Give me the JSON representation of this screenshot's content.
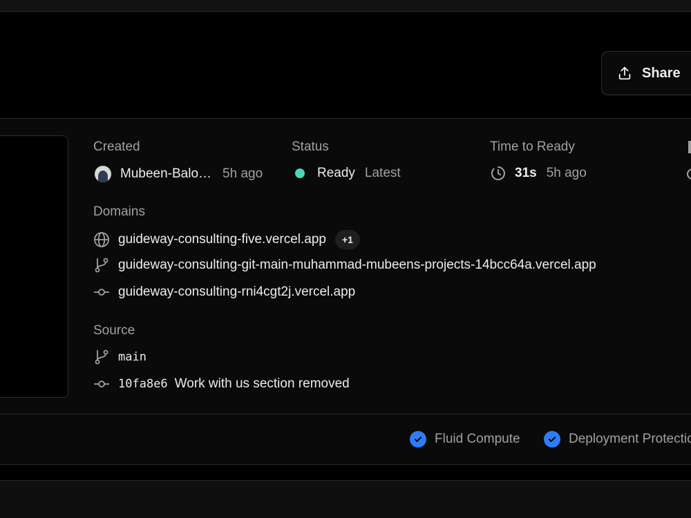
{
  "header": {
    "share_label": "Share"
  },
  "created": {
    "label": "Created",
    "author": "Mubeen-Balo…",
    "time": "5h ago"
  },
  "status": {
    "label": "Status",
    "value": "Ready",
    "tag": "Latest",
    "color": "#4cd6b8"
  },
  "time_to_ready": {
    "label": "Time to Ready",
    "duration": "31s",
    "time": "5h ago"
  },
  "domains": {
    "label": "Domains",
    "items": [
      {
        "icon": "globe-icon",
        "text": "guideway-consulting-five.vercel.app",
        "badge": "+1"
      },
      {
        "icon": "branch-icon",
        "text": "guideway-consulting-git-main-muhammad-mubeens-projects-14bcc64a.vercel.app"
      },
      {
        "icon": "commit-icon",
        "text": "guideway-consulting-rni4cgt2j.vercel.app"
      }
    ]
  },
  "source": {
    "label": "Source",
    "branch": "main",
    "commit_hash": "10fa8e6",
    "commit_message": "Work with us section removed"
  },
  "features": [
    {
      "label": "Fluid Compute",
      "icon": "check-circle-icon"
    },
    {
      "label": "Deployment Protection",
      "icon": "check-circle-icon"
    }
  ],
  "colors": {
    "accent_blue": "#2f7df6",
    "ready_green": "#4cd6b8"
  }
}
